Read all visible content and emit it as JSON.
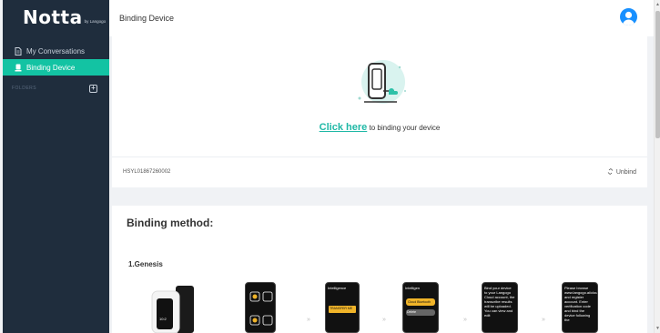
{
  "sidebar": {
    "logo": "Notta",
    "logo_sub": "by Langogo",
    "items": [
      {
        "label": "My Conversations",
        "icon": "document-icon"
      },
      {
        "label": "Binding Device",
        "icon": "device-icon"
      }
    ],
    "folders_label": "FOLDERS",
    "add_icon": "plus-icon"
  },
  "header": {
    "title": "Binding Device",
    "avatar_icon": "user-avatar-icon"
  },
  "binding": {
    "link_text": "Click here",
    "rest_text": "to binding your device",
    "serial": "HSYL01867260002",
    "unbind": "Unbind"
  },
  "method": {
    "title": "Binding method:",
    "product": "1.Genesis",
    "step2_title": "Intelligence",
    "step2_btn": "TRANSFER ME",
    "step3_title": "Intelligen",
    "step3_btn": "Cloud Bluetooth",
    "step3_btn2": "Delete",
    "step4_text": "Bind your device to your Langogo Cloud account, the transcribe results will be uploaded. You can view and edit",
    "step5_text": "Please browse www.langogo.ai/cloud and register account. Enter verification code and bind the device following the"
  },
  "colors": {
    "sidebar": "#1f2d3d",
    "accent": "#13c3a3",
    "link": "#1fb8a6",
    "avatar": "#1890ff"
  }
}
